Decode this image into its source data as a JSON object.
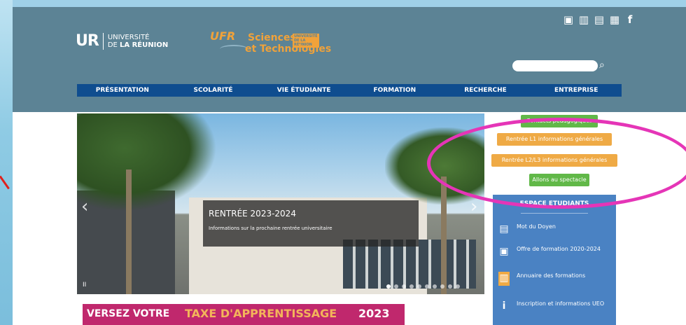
{
  "logos": {
    "ur_mark": "UR",
    "ur_line1": "UNIVERSITÉ",
    "ur_line2_de": "DE ",
    "ur_line2_name": "LA RÉUNION",
    "ufr": "UFR",
    "sciences": "Sciences",
    "badge": "UNIVERSITÉ DE LA RÉUNION",
    "technologies": "et Technologies"
  },
  "top_icons": [
    "photo-icon",
    "library-icon",
    "directory-icon",
    "calendar-icon",
    "facebook-icon"
  ],
  "search": {
    "placeholder": ""
  },
  "nav": [
    "PRÉSENTATION",
    "SCOLARITÉ",
    "VIE ÉTUDIANTE",
    "FORMATION",
    "RECHERCHE",
    "ENTREPRISE"
  ],
  "hero": {
    "title": "RENTRÉE 2023-2024",
    "subtitle": "Informations sur la prochaine rentrée universitaire",
    "pause": "II"
  },
  "banner": {
    "part1": "VERSEZ VOTRE",
    "part2": "TAXE D'APPRENTISSAGE",
    "year": "2023"
  },
  "side": {
    "contacts": "Contacts pédagogiques",
    "rentree_l1": "Rentrée L1 informations générales",
    "rentree_l2l3": "Rentrée L2/L3 informations générales",
    "spectacle": "Allons au spectacle",
    "espace_title": "ESPACE ETUDIANTS",
    "items": [
      {
        "label": "Mot du Doyen",
        "icon": "document-icon"
      },
      {
        "label": "Offre de formation 2020-2024",
        "icon": "book-icon"
      },
      {
        "label": "Annuaire des formations",
        "icon": "directory-icon"
      },
      {
        "label": "Inscription et informations UEO",
        "icon": "info-icon"
      }
    ]
  },
  "colors": {
    "header": "#5c8395",
    "nav": "#0f4d8f",
    "green": "#61b848",
    "orange": "#efaa45",
    "espace": "#4a82c3",
    "banner": "#c0286d",
    "highlight": "#e535b7"
  }
}
